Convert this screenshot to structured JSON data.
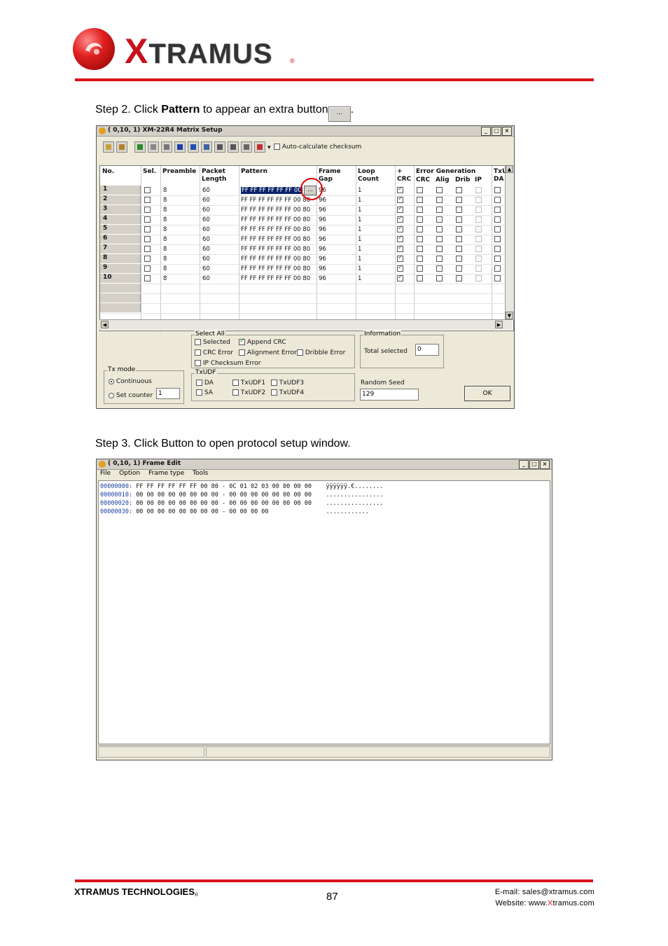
{
  "header": {
    "logo_first_letter": "X",
    "logo_rest": "TRAMUS",
    "logo_registered": "®",
    "brand_color": "#d9141b"
  },
  "step2": {
    "prefix": "Step 2. Click ",
    "bold": "Pattern",
    "suffix": " to appear an extra button",
    "button_label": "...",
    "period": "."
  },
  "matrix_window": {
    "title": "( 0,10, 1) XM-22R4 Matrix Setup",
    "auto_checksum_label": "Auto-calculate checksum",
    "columns": {
      "no": "No.",
      "sel": "Sel.",
      "preamble": "Preamble",
      "packet_length_1": "Packet",
      "packet_length_2": "Length",
      "pattern": "Pattern",
      "frame_gap_1": "Frame",
      "frame_gap_2": "Gap",
      "loop_count_1": "Loop",
      "loop_count_2": "Count",
      "plus_crc_1": "+",
      "plus_crc_2": "CRC",
      "error_generation": "Error Generation",
      "err_crc": "CRC",
      "err_align": "Alig",
      "err_drib": "Drib",
      "err_ip": "IP",
      "txu_1": "TxU",
      "txu_2": "DA"
    },
    "rows": [
      {
        "no": "1",
        "preamble": "8",
        "length": "60",
        "pattern": "FF FF FF FF FF FF 00",
        "gap": "96",
        "loop": "1"
      },
      {
        "no": "2",
        "preamble": "8",
        "length": "60",
        "pattern": "FF FF FF FF FF FF 00 80",
        "gap": "96",
        "loop": "1"
      },
      {
        "no": "3",
        "preamble": "8",
        "length": "60",
        "pattern": "FF FF FF FF FF FF 00 80",
        "gap": "96",
        "loop": "1"
      },
      {
        "no": "4",
        "preamble": "8",
        "length": "60",
        "pattern": "FF FF FF FF FF FF 00 80",
        "gap": "96",
        "loop": "1"
      },
      {
        "no": "5",
        "preamble": "8",
        "length": "60",
        "pattern": "FF FF FF FF FF FF 00 80",
        "gap": "96",
        "loop": "1"
      },
      {
        "no": "6",
        "preamble": "8",
        "length": "60",
        "pattern": "FF FF FF FF FF FF 00 80",
        "gap": "96",
        "loop": "1"
      },
      {
        "no": "7",
        "preamble": "8",
        "length": "60",
        "pattern": "FF FF FF FF FF FF 00 80",
        "gap": "96",
        "loop": "1"
      },
      {
        "no": "8",
        "preamble": "8",
        "length": "60",
        "pattern": "FF FF FF FF FF FF 00 80",
        "gap": "96",
        "loop": "1"
      },
      {
        "no": "9",
        "preamble": "8",
        "length": "60",
        "pattern": "FF FF FF FF FF FF 00 80",
        "gap": "96",
        "loop": "1"
      },
      {
        "no": "10",
        "preamble": "8",
        "length": "60",
        "pattern": "FF FF FF FF FF FF 00 80",
        "gap": "96",
        "loop": "1"
      }
    ],
    "pattern_button_label": "...",
    "select_all": {
      "title": "Select All",
      "selected": "Selected",
      "append_crc": "Append CRC",
      "crc_error": "CRC Error",
      "alignment_error": "Alignment Error",
      "dribble_error": "Dribble Error",
      "ip_checksum_error": "IP Checksum Error"
    },
    "txudf": {
      "title": "TxUDF",
      "da": "DA",
      "sa": "SA",
      "txudf1": "TxUDF1",
      "txudf2": "TxUDF2",
      "txudf3": "TxUDF3",
      "txudf4": "TxUDF4"
    },
    "information": {
      "title": "Information",
      "total_selected_label": "Total selected",
      "total_selected_value": "0"
    },
    "tx_mode": {
      "title": "Tx mode",
      "continuous": "Continuous",
      "set_counter": "Set counter",
      "counter_value": "1"
    },
    "random_seed_label": "Random Seed",
    "random_seed_value": "129",
    "ok_label": "OK"
  },
  "step3": {
    "text": "Step 3. Click Button to open protocol setup window."
  },
  "frame_window": {
    "title": "( 0,10, 1) Frame Edit",
    "menu": [
      "File",
      "Option",
      "Frame type",
      "Tools"
    ],
    "hex_lines": [
      {
        "addr": "00000000:",
        "bytes": "FF FF FF FF FF FF 00 80 - 0C 01 02 03 00 00 00 00",
        "ascii": "ÿÿÿÿÿÿ.€........"
      },
      {
        "addr": "00000010:",
        "bytes": "00 00 00 00 00 00 00 00 - 00 00 00 00 00 00 00 00",
        "ascii": "................"
      },
      {
        "addr": "00000020:",
        "bytes": "00 00 00 00 00 00 00 00 - 00 00 00 00 00 00 00 00",
        "ascii": "................"
      },
      {
        "addr": "00000030:",
        "bytes": "00 00 00 00 00 00 00 00 - 00 00 00 00",
        "ascii": "............"
      }
    ]
  },
  "footer": {
    "company": "XTRAMUS TECHNOLOGIES",
    "registered": "®",
    "page_number": "87",
    "email": "E-mail: sales@xtramus.com",
    "website_prefix": "Website: www.",
    "website_x": "X",
    "website_suffix": "tramus.com"
  }
}
